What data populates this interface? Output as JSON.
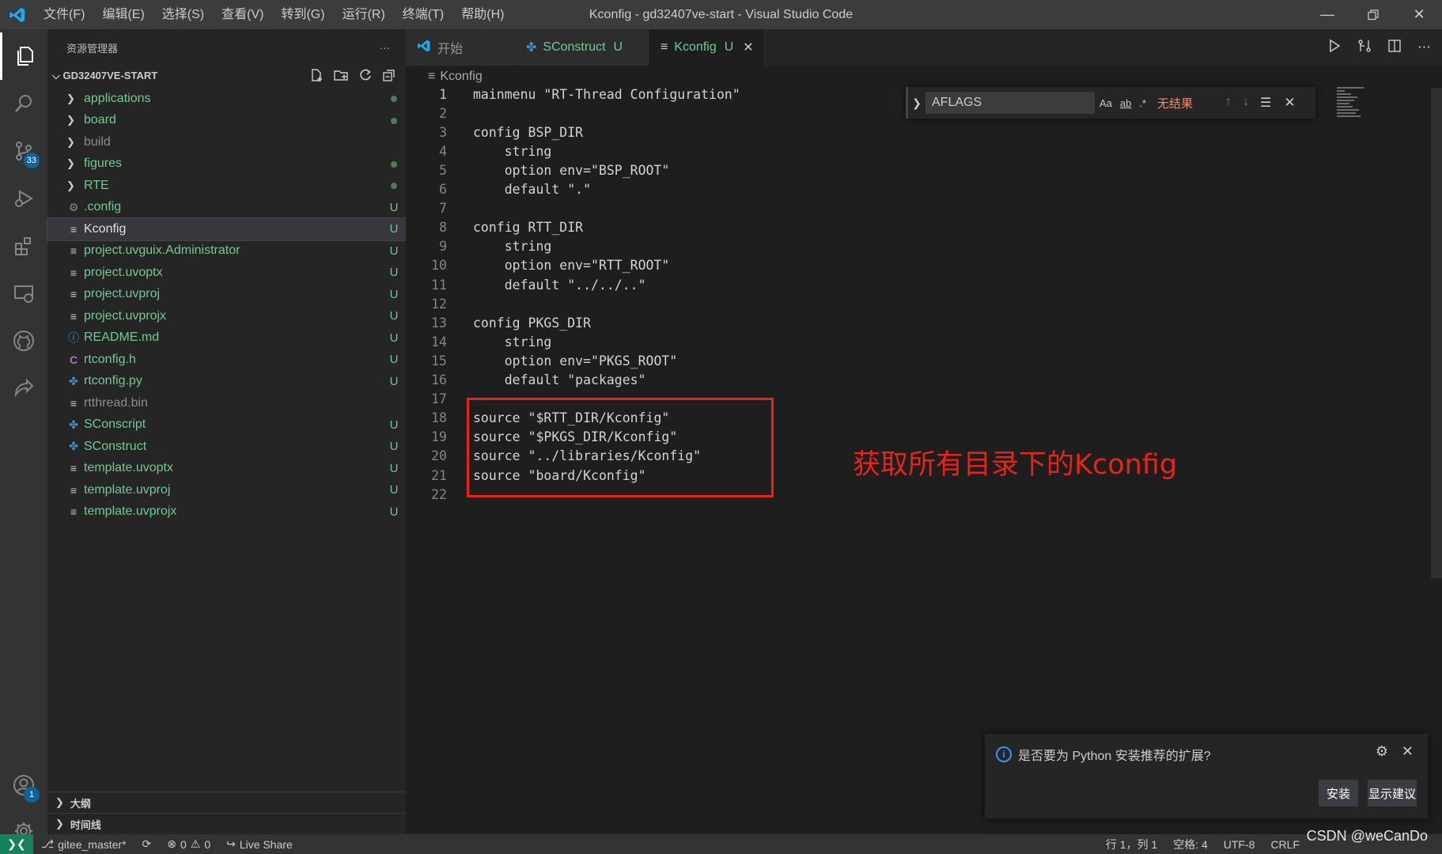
{
  "window": {
    "title": "Kconfig - gd32407ve-start - Visual Studio Code",
    "menu": [
      "文件(F)",
      "编辑(E)",
      "选择(S)",
      "查看(V)",
      "转到(G)",
      "运行(R)",
      "终端(T)",
      "帮助(H)"
    ]
  },
  "activity": {
    "scm_badge": "33",
    "accounts_badge": "1"
  },
  "sidebar": {
    "title": "资源管理器",
    "more": "···",
    "folder": "GD32407VE-START",
    "items": [
      {
        "name": "applications",
        "type": "folder",
        "deco": "dot",
        "color": "green"
      },
      {
        "name": "board",
        "type": "folder",
        "deco": "dot",
        "color": "green"
      },
      {
        "name": "build",
        "type": "folder",
        "deco": "",
        "color": "grey"
      },
      {
        "name": "figures",
        "type": "folder",
        "deco": "dot",
        "color": "green"
      },
      {
        "name": "RTE",
        "type": "folder",
        "deco": "dot",
        "color": "green"
      },
      {
        "name": ".config",
        "type": "gear",
        "deco": "U",
        "color": "green"
      },
      {
        "name": "Kconfig",
        "type": "lines",
        "deco": "U",
        "color": "white"
      },
      {
        "name": "project.uvguix.Administrator",
        "type": "lines",
        "deco": "U",
        "color": "green"
      },
      {
        "name": "project.uvoptx",
        "type": "lines",
        "deco": "U",
        "color": "green"
      },
      {
        "name": "project.uvproj",
        "type": "lines",
        "deco": "U",
        "color": "green"
      },
      {
        "name": "project.uvprojx",
        "type": "lines",
        "deco": "U",
        "color": "green"
      },
      {
        "name": "README.md",
        "type": "info",
        "deco": "U",
        "color": "green"
      },
      {
        "name": "rtconfig.h",
        "type": "c",
        "deco": "U",
        "color": "green"
      },
      {
        "name": "rtconfig.py",
        "type": "python",
        "deco": "U",
        "color": "green"
      },
      {
        "name": "rtthread.bin",
        "type": "lines",
        "deco": "",
        "color": "grey"
      },
      {
        "name": "SConscript",
        "type": "python",
        "deco": "U",
        "color": "green"
      },
      {
        "name": "SConstruct",
        "type": "python",
        "deco": "U",
        "color": "green"
      },
      {
        "name": "template.uvoptx",
        "type": "lines",
        "deco": "U",
        "color": "green"
      },
      {
        "name": "template.uvproj",
        "type": "lines",
        "deco": "U",
        "color": "green"
      },
      {
        "name": "template.uvprojx",
        "type": "lines",
        "deco": "U",
        "color": "green"
      }
    ],
    "outline": "大纲",
    "timeline": "时间线"
  },
  "tabs": [
    {
      "label": "开始",
      "mod": "",
      "active": false
    },
    {
      "label": "SConstruct",
      "mod": "U",
      "active": false
    },
    {
      "label": "Kconfig",
      "mod": "U",
      "active": true
    }
  ],
  "breadcrumb": "Kconfig",
  "editor": {
    "lines": [
      "mainmenu \"RT-Thread Configuration\"",
      "",
      "config BSP_DIR",
      "    string",
      "    option env=\"BSP_ROOT\"",
      "    default \".\"",
      "",
      "config RTT_DIR",
      "    string",
      "    option env=\"RTT_ROOT\"",
      "    default \"../../..\"",
      "",
      "config PKGS_DIR",
      "    string",
      "    option env=\"PKGS_ROOT\"",
      "    default \"packages\"",
      "",
      "source \"$RTT_DIR/Kconfig\"",
      "source \"$PKGS_DIR/Kconfig\"",
      "source \"../libraries/Kconfig\"",
      "source \"board/Kconfig\"",
      ""
    ],
    "annotation": "获取所有目录下的Kconfig"
  },
  "find": {
    "query": "AFLAGS",
    "opt_case": "Aa",
    "opt_word": "ab",
    "opt_regex": ".*",
    "result": "无结果"
  },
  "notification": {
    "message": "是否要为 Python 安装推荐的扩展?",
    "install": "安装",
    "show": "显示建议"
  },
  "status": {
    "branch": "gitee_master*",
    "errors": "0",
    "warnings": "0",
    "liveshare": "Live Share",
    "position": "行 1，列 1",
    "spaces": "空格: 4",
    "encoding": "UTF-8",
    "eol": "CRLF",
    "watermark": "CSDN @weCanDo"
  },
  "colors": {
    "accent_green": "#73c991",
    "annotation_red": "#e8231a",
    "badge_blue": "#0e639c",
    "remote_green": "#16825d"
  }
}
